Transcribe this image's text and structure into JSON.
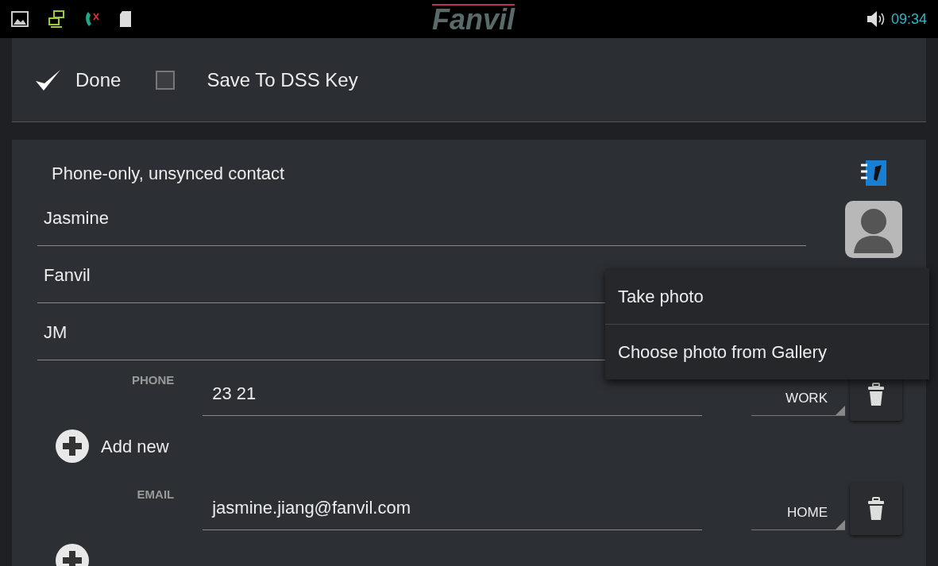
{
  "status_bar": {
    "logo": "Fanvil",
    "time": "09:34"
  },
  "action_bar": {
    "done": "Done",
    "save_to_dss": {
      "label": "Save To DSS Key",
      "checked": false
    }
  },
  "account": {
    "label": "Phone-only, unsynced contact"
  },
  "name_fields": [
    {
      "value": "Jasmine"
    },
    {
      "value": "Fanvil"
    },
    {
      "value": "JM"
    }
  ],
  "entries": [
    {
      "label": "PHONE",
      "value": "23 21",
      "type": "WORK",
      "add_label": "Add new"
    },
    {
      "label": "EMAIL",
      "value": "jasmine.jiang@fanvil.com",
      "type": "HOME"
    }
  ],
  "photo_menu": [
    {
      "label": "Take photo"
    },
    {
      "label": "Choose photo from Gallery"
    }
  ]
}
